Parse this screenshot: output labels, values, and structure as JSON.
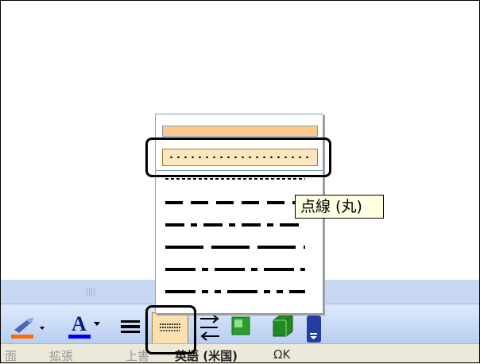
{
  "tooltip": {
    "text": "点線 (丸)"
  },
  "line_styles": [
    "solid-thin",
    "round-dot",
    "square-dot",
    "dash",
    "dash-dot",
    "long-dash",
    "long-dash-dot",
    "long-dash-dot-dot"
  ],
  "toolbar": {
    "font_color_label": "A",
    "items": [
      "line-color-icon",
      "font-color-icon",
      "line-style-icon",
      "dash-style-icon",
      "arrow-style-icon",
      "shadow-style-icon",
      "3d-style-icon",
      "toolbar-options-icon"
    ]
  },
  "statusbar": {
    "text1": "面",
    "text2": "拡張",
    "text3": "上書",
    "text4": "英語 (米国)",
    "text5": "ΩΚ"
  },
  "colors": {
    "highlight": "#000000",
    "selected_fill": "#fde6bf",
    "band": "#c7d7f2"
  }
}
